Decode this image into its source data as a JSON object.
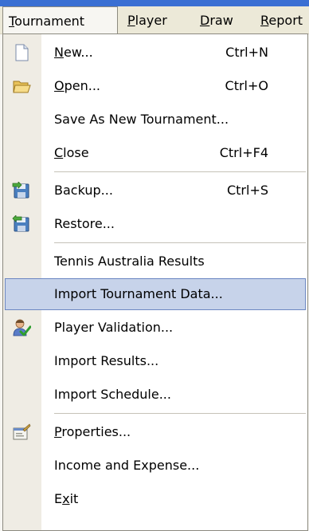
{
  "menubar": {
    "items": [
      {
        "pre": "",
        "key": "T",
        "post": "ournament"
      },
      {
        "pre": "",
        "key": "P",
        "post": "layer"
      },
      {
        "pre": "",
        "key": "D",
        "post": "raw"
      },
      {
        "pre": "",
        "key": "R",
        "post": "eport"
      }
    ]
  },
  "menu": {
    "items": [
      {
        "pre": "",
        "key": "N",
        "post": "ew...",
        "shortcut": "Ctrl+N",
        "icon": "new-document-icon"
      },
      {
        "pre": "",
        "key": "O",
        "post": "pen...",
        "shortcut": "Ctrl+O",
        "icon": "open-folder-icon"
      },
      {
        "pre": "Save As New Tournament...",
        "key": "",
        "post": "",
        "shortcut": "",
        "icon": ""
      },
      {
        "pre": "",
        "key": "C",
        "post": "lose",
        "shortcut": "Ctrl+F4",
        "icon": ""
      },
      {
        "pre": "Backup...",
        "key": "",
        "post": "",
        "shortcut": "Ctrl+S",
        "icon": "backup-disk-icon"
      },
      {
        "pre": "Restore...",
        "key": "",
        "post": "",
        "shortcut": "",
        "icon": "restore-disk-icon"
      },
      {
        "pre": "Tennis Australia Results",
        "key": "",
        "post": "",
        "shortcut": "",
        "icon": ""
      },
      {
        "pre": "Import Tournament Data...",
        "key": "",
        "post": "",
        "shortcut": "",
        "icon": "",
        "highlighted": true
      },
      {
        "pre": "Player Validation...",
        "key": "",
        "post": "",
        "shortcut": "",
        "icon": "player-check-icon"
      },
      {
        "pre": "Import Results...",
        "key": "",
        "post": "",
        "shortcut": "",
        "icon": ""
      },
      {
        "pre": "Import Schedule...",
        "key": "",
        "post": "",
        "shortcut": "",
        "icon": ""
      },
      {
        "pre": "",
        "key": "P",
        "post": "roperties...",
        "shortcut": "",
        "icon": "properties-icon"
      },
      {
        "pre": "Income and Expense...",
        "key": "",
        "post": "",
        "shortcut": "",
        "icon": ""
      },
      {
        "pre": "E",
        "key": "x",
        "post": "it",
        "shortcut": "",
        "icon": ""
      }
    ]
  },
  "colors": {
    "highlight_fill": "#c7d3ea",
    "highlight_border": "#6c87c2",
    "menubar_bg": "#ece9d8",
    "gutter_bg": "#efece4"
  }
}
